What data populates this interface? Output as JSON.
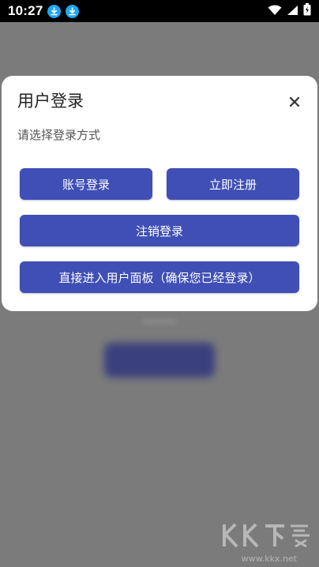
{
  "status_bar": {
    "time": "10:27",
    "left_icons": [
      "download-icon",
      "download-icon"
    ],
    "right_icons": [
      "wifi-icon",
      "signal-icon",
      "battery-charging-icon"
    ]
  },
  "dialog": {
    "title": "用户登录",
    "subtitle": "请选择登录方式",
    "close_icon": "close-icon",
    "buttons": {
      "login": "账号登录",
      "register": "立即注册",
      "logout": "注销登录",
      "panel": "直接进入用户面板（确保您已经登录）"
    }
  },
  "watermark": {
    "text": "KK下载",
    "url": "www.kkx.net"
  },
  "colors": {
    "button": "#3f4fb5",
    "overlay": "#7b7b7b",
    "status_icon": "#1fa6f2"
  }
}
